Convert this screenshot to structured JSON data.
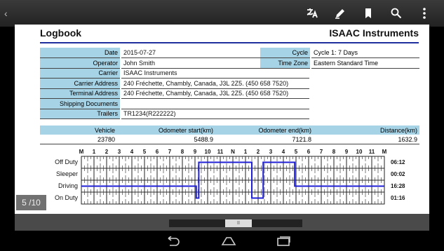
{
  "appbar": {
    "back_glyph": "‹",
    "actions": [
      {
        "name": "translate-icon"
      },
      {
        "name": "edit-icon"
      },
      {
        "name": "bookmark-icon"
      },
      {
        "name": "search-icon"
      },
      {
        "name": "overflow-menu-icon"
      }
    ]
  },
  "document": {
    "title": "Logbook",
    "company": "ISAAC Instruments",
    "fields": [
      {
        "label": "Date",
        "value": "2015-07-27"
      },
      {
        "label": "Operator",
        "value": "John Smith"
      },
      {
        "label": "Carrier",
        "value": "ISAAC Instruments"
      },
      {
        "label": "Carrier Address",
        "value": "240 Fréchette, Chambly, Canada, J3L 2Z5. (450 658 7520)"
      },
      {
        "label": "Terminal Address",
        "value": "240 Fréchette, Chambly, Canada, J3L 2Z5. (450 658 7520)"
      },
      {
        "label": "Shipping Documents",
        "value": ""
      },
      {
        "label": "Trailers",
        "value": "TR1234(R222222)"
      }
    ],
    "right_fields": [
      {
        "label": "Cycle",
        "value": "Cycle 1: 7 Days"
      },
      {
        "label": "Time Zone",
        "value": "Eastern Standard Time"
      }
    ],
    "odometer": {
      "headers": [
        "Vehicle",
        "Odometer start(km)",
        "Odometer end(km)",
        "Distance(km)"
      ],
      "values": [
        "23780",
        "5488.9",
        "7121.8",
        "1632.9"
      ]
    },
    "graph": {
      "hour_labels": [
        "M",
        "1",
        "2",
        "3",
        "4",
        "5",
        "6",
        "7",
        "8",
        "9",
        "10",
        "11",
        "N",
        "1",
        "2",
        "3",
        "4",
        "5",
        "6",
        "7",
        "8",
        "9",
        "10",
        "11",
        "M"
      ],
      "rows": [
        {
          "label": "Off Duty",
          "total": "06:12"
        },
        {
          "label": "Sleeper",
          "total": "00:02"
        },
        {
          "label": "Driving",
          "total": "16:28"
        },
        {
          "label": "On Duty",
          "total": "01:16"
        }
      ],
      "line_color": "#1f1fd6",
      "status_segments": [
        {
          "row": 2,
          "from": 0.0,
          "to": 9.1
        },
        {
          "row": 3,
          "from": 9.1,
          "to": 9.3
        },
        {
          "row": 0,
          "from": 9.3,
          "to": 13.5
        },
        {
          "row": 3,
          "from": 13.5,
          "to": 14.4
        },
        {
          "row": 0,
          "from": 14.4,
          "to": 16.9
        },
        {
          "row": 2,
          "from": 16.9,
          "to": 24.0
        }
      ]
    }
  },
  "page_indicator": "5 /10",
  "navbar": [
    {
      "name": "back-nav-icon"
    },
    {
      "name": "home-nav-icon"
    },
    {
      "name": "recents-nav-icon"
    }
  ]
}
